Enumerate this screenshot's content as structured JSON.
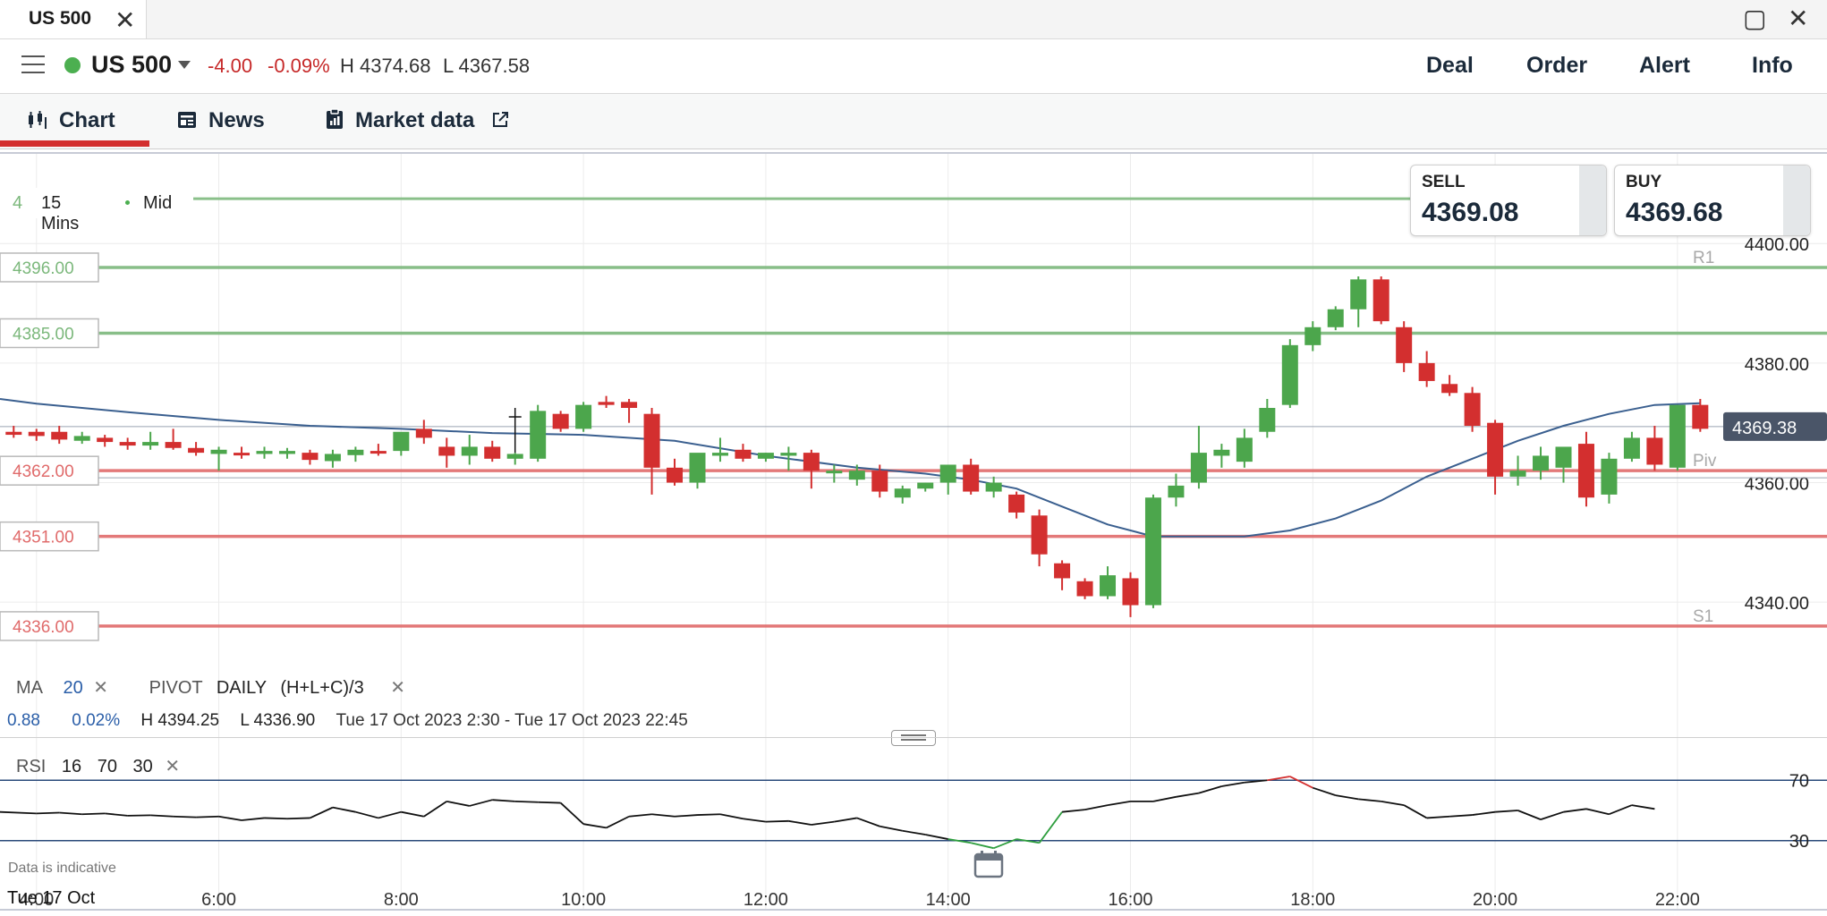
{
  "window": {
    "tab_title": "US 500",
    "close_glyph": "✕",
    "maximize_glyph": "▢",
    "window_close_glyph": "✕"
  },
  "header": {
    "instrument": "US 500",
    "change": "-4.00",
    "change_pct": "-0.09%",
    "high": "H 4374.68",
    "low": "L 4367.58",
    "actions": {
      "deal": "Deal",
      "order": "Order",
      "alert": "Alert",
      "info": "Info"
    }
  },
  "tabs": {
    "chart": "Chart",
    "news": "News",
    "market_data": "Market data"
  },
  "chart_controls": {
    "timeframe": "15 Mins",
    "price_type": "Mid",
    "cut_label": "4"
  },
  "quote": {
    "sell_label": "SELL",
    "sell_price": "4369.08",
    "buy_label": "BUY",
    "buy_price": "4369.68"
  },
  "indicators": {
    "ma_label": "MA",
    "ma_period": "20",
    "pivot_label": "PIVOT",
    "pivot_period": "DAILY",
    "pivot_formula": "(H+L+C)/3",
    "summary_change": "0.88",
    "summary_pct": "0.02%",
    "summary_high": "H 4394.25",
    "summary_low": "L 4336.90",
    "summary_range": "Tue 17 Oct 2023 2:30 - Tue 17 Oct 2023 22:45",
    "rsi_label": "RSI",
    "rsi_period": "16",
    "rsi_upper": "70",
    "rsi_lower": "30"
  },
  "footer": {
    "disclaimer": "Data is indicative",
    "date_label": "Tue 17 Oct"
  },
  "colors": {
    "up": "#4ca64c",
    "down": "#d32f2f",
    "ma": "#3a5f8f",
    "accent": "#d32f2f",
    "price_tag": "#4a5568"
  },
  "icons": {
    "menu": "menu-icon",
    "chart": "candlestick-icon",
    "news": "newspaper-icon",
    "market": "clipboard-icon",
    "external": "external-link-icon",
    "calendar": "calendar-icon"
  },
  "chart_data": {
    "type": "candlestick",
    "y_range": [
      4330,
      4415
    ],
    "y_ticks": [
      "4400.00",
      "4380.00",
      "4360.00",
      "4340.00"
    ],
    "y_tick_values": [
      4400,
      4380,
      4360,
      4340
    ],
    "x_range": [
      3.6,
      22.6
    ],
    "x_ticks": [
      "4:00",
      "6:00",
      "8:00",
      "10:00",
      "12:00",
      "14:00",
      "16:00",
      "18:00",
      "20:00",
      "22:00"
    ],
    "x_tick_values": [
      4,
      6,
      8,
      10,
      12,
      14,
      16,
      18,
      20,
      22
    ],
    "current_price": {
      "value": 4369.38,
      "label": "4369.38"
    },
    "levels": [
      {
        "value": 4396.0,
        "label": "4396.00",
        "kind": "resistance",
        "tag": "R1"
      },
      {
        "value": 4385.0,
        "label": "4385.00",
        "kind": "resistance",
        "tag": ""
      },
      {
        "value": 4362.0,
        "label": "4362.00",
        "kind": "support",
        "tag": "Piv"
      },
      {
        "value": 4351.0,
        "label": "4351.00",
        "kind": "support",
        "tag": ""
      },
      {
        "value": 4336.0,
        "label": "4336.00",
        "kind": "support",
        "tag": "S1"
      }
    ],
    "top_line_value": 4407.5,
    "candles": [
      {
        "t": 3.5,
        "o": 4368.0,
        "h": 4369.0,
        "l": 4367.0,
        "c": 4368.5
      },
      {
        "t": 3.75,
        "o": 4368.5,
        "h": 4369.5,
        "l": 4367.5,
        "c": 4368.0
      },
      {
        "t": 4.0,
        "o": 4368.5,
        "h": 4369.0,
        "l": 4367.0,
        "c": 4367.8
      },
      {
        "t": 4.25,
        "o": 4368.5,
        "h": 4369.5,
        "l": 4366.5,
        "c": 4367.2
      },
      {
        "t": 4.5,
        "o": 4367.0,
        "h": 4368.5,
        "l": 4366.5,
        "c": 4367.8
      },
      {
        "t": 4.75,
        "o": 4367.5,
        "h": 4368.0,
        "l": 4366.0,
        "c": 4366.8
      },
      {
        "t": 5.0,
        "o": 4366.8,
        "h": 4367.5,
        "l": 4365.5,
        "c": 4366.2
      },
      {
        "t": 5.25,
        "o": 4366.2,
        "h": 4368.5,
        "l": 4365.5,
        "c": 4366.8
      },
      {
        "t": 5.5,
        "o": 4366.8,
        "h": 4369.0,
        "l": 4365.5,
        "c": 4365.8
      },
      {
        "t": 5.75,
        "o": 4365.8,
        "h": 4366.8,
        "l": 4364.5,
        "c": 4365.0
      },
      {
        "t": 6.0,
        "o": 4364.8,
        "h": 4366.0,
        "l": 4362.0,
        "c": 4365.5
      },
      {
        "t": 6.25,
        "o": 4365.0,
        "h": 4366.0,
        "l": 4364.0,
        "c": 4364.6
      },
      {
        "t": 6.5,
        "o": 4364.8,
        "h": 4366.0,
        "l": 4364.0,
        "c": 4365.3
      },
      {
        "t": 6.75,
        "o": 4364.8,
        "h": 4365.8,
        "l": 4364.0,
        "c": 4365.3
      },
      {
        "t": 7.0,
        "o": 4365.0,
        "h": 4365.5,
        "l": 4363.0,
        "c": 4363.8
      },
      {
        "t": 7.25,
        "o": 4363.6,
        "h": 4365.5,
        "l": 4362.5,
        "c": 4364.8
      },
      {
        "t": 7.5,
        "o": 4364.6,
        "h": 4366.0,
        "l": 4363.5,
        "c": 4365.5
      },
      {
        "t": 7.75,
        "o": 4365.3,
        "h": 4366.5,
        "l": 4364.5,
        "c": 4365.0
      },
      {
        "t": 8.0,
        "o": 4365.3,
        "h": 4367.5,
        "l": 4364.5,
        "c": 4368.5
      },
      {
        "t": 8.25,
        "o": 4369.0,
        "h": 4370.5,
        "l": 4366.5,
        "c": 4367.5
      },
      {
        "t": 8.5,
        "o": 4366.0,
        "h": 4367.5,
        "l": 4362.5,
        "c": 4364.5
      },
      {
        "t": 8.75,
        "o": 4364.5,
        "h": 4368.0,
        "l": 4363.0,
        "c": 4366.0
      },
      {
        "t": 9.0,
        "o": 4366.0,
        "h": 4367.0,
        "l": 4363.5,
        "c": 4364.0
      },
      {
        "t": 9.25,
        "o": 4364.0,
        "h": 4365.0,
        "l": 4363.0,
        "c": 4364.8
      },
      {
        "t": 9.5,
        "o": 4364.0,
        "h": 4373.0,
        "l": 4363.5,
        "c": 4372.0
      },
      {
        "t": 9.75,
        "o": 4371.5,
        "h": 4372.0,
        "l": 4368.5,
        "c": 4369.0
      },
      {
        "t": 10.0,
        "o": 4369.0,
        "h": 4373.5,
        "l": 4368.5,
        "c": 4373.0
      },
      {
        "t": 10.25,
        "o": 4373.5,
        "h": 4374.5,
        "l": 4372.5,
        "c": 4373.0
      },
      {
        "t": 10.5,
        "o": 4373.5,
        "h": 4374.0,
        "l": 4370.0,
        "c": 4372.5
      },
      {
        "t": 10.75,
        "o": 4371.5,
        "h": 4372.5,
        "l": 4358.0,
        "c": 4362.5
      },
      {
        "t": 11.0,
        "o": 4362.5,
        "h": 4364.0,
        "l": 4359.5,
        "c": 4360.0
      },
      {
        "t": 11.25,
        "o": 4360.0,
        "h": 4364.5,
        "l": 4359.0,
        "c": 4365.0
      },
      {
        "t": 11.5,
        "o": 4364.5,
        "h": 4367.5,
        "l": 4363.5,
        "c": 4365.0
      },
      {
        "t": 11.75,
        "o": 4365.5,
        "h": 4366.5,
        "l": 4363.5,
        "c": 4364.0
      },
      {
        "t": 12.0,
        "o": 4364.0,
        "h": 4365.0,
        "l": 4363.5,
        "c": 4365.0
      },
      {
        "t": 12.25,
        "o": 4364.5,
        "h": 4366.0,
        "l": 4362.0,
        "c": 4365.0
      },
      {
        "t": 12.5,
        "o": 4365.0,
        "h": 4365.5,
        "l": 4359.0,
        "c": 4362.0
      },
      {
        "t": 12.75,
        "o": 4362.0,
        "h": 4363.0,
        "l": 4360.0,
        "c": 4362.0
      },
      {
        "t": 13.0,
        "o": 4360.5,
        "h": 4363.0,
        "l": 4359.5,
        "c": 4362.0
      },
      {
        "t": 13.25,
        "o": 4362.0,
        "h": 4363.0,
        "l": 4357.5,
        "c": 4358.5
      },
      {
        "t": 13.5,
        "o": 4357.5,
        "h": 4359.5,
        "l": 4356.5,
        "c": 4359.0
      },
      {
        "t": 13.75,
        "o": 4359.0,
        "h": 4360.0,
        "l": 4358.5,
        "c": 4360.0
      },
      {
        "t": 14.0,
        "o": 4360.0,
        "h": 4363.0,
        "l": 4358.0,
        "c": 4363.0
      },
      {
        "t": 14.25,
        "o": 4363.0,
        "h": 4364.0,
        "l": 4358.0,
        "c": 4358.5
      },
      {
        "t": 14.5,
        "o": 4358.5,
        "h": 4361.0,
        "l": 4357.5,
        "c": 4360.0
      },
      {
        "t": 14.75,
        "o": 4358.0,
        "h": 4358.5,
        "l": 4354.0,
        "c": 4355.0
      },
      {
        "t": 15.0,
        "o": 4354.5,
        "h": 4355.5,
        "l": 4346.0,
        "c": 4348.0
      },
      {
        "t": 15.25,
        "o": 4346.5,
        "h": 4347.0,
        "l": 4342.0,
        "c": 4344.0
      },
      {
        "t": 15.5,
        "o": 4343.5,
        "h": 4344.0,
        "l": 4340.5,
        "c": 4341.0
      },
      {
        "t": 15.75,
        "o": 4341.0,
        "h": 4346.0,
        "l": 4340.5,
        "c": 4344.5
      },
      {
        "t": 16.0,
        "o": 4344.0,
        "h": 4345.0,
        "l": 4337.5,
        "c": 4339.5
      },
      {
        "t": 16.25,
        "o": 4339.5,
        "h": 4358.0,
        "l": 4339.0,
        "c": 4357.5
      },
      {
        "t": 16.5,
        "o": 4357.5,
        "h": 4361.5,
        "l": 4356.0,
        "c": 4359.5
      },
      {
        "t": 16.75,
        "o": 4360.0,
        "h": 4369.5,
        "l": 4359.0,
        "c": 4365.0
      },
      {
        "t": 17.0,
        "o": 4364.5,
        "h": 4366.5,
        "l": 4362.5,
        "c": 4365.5
      },
      {
        "t": 17.25,
        "o": 4363.5,
        "h": 4369.0,
        "l": 4362.5,
        "c": 4367.5
      },
      {
        "t": 17.5,
        "o": 4368.5,
        "h": 4374.0,
        "l": 4367.5,
        "c": 4372.5
      },
      {
        "t": 17.75,
        "o": 4373.0,
        "h": 4384.0,
        "l": 4372.5,
        "c": 4383.0
      },
      {
        "t": 18.0,
        "o": 4383.0,
        "h": 4387.0,
        "l": 4382.0,
        "c": 4386.0
      },
      {
        "t": 18.25,
        "o": 4386.0,
        "h": 4389.5,
        "l": 4385.5,
        "c": 4389.0
      },
      {
        "t": 18.5,
        "o": 4389.0,
        "h": 4394.5,
        "l": 4386.0,
        "c": 4394.0
      },
      {
        "t": 18.75,
        "o": 4394.0,
        "h": 4394.5,
        "l": 4386.5,
        "c": 4387.0
      },
      {
        "t": 19.0,
        "o": 4386.0,
        "h": 4387.0,
        "l": 4378.5,
        "c": 4380.0
      },
      {
        "t": 19.25,
        "o": 4380.0,
        "h": 4382.0,
        "l": 4376.0,
        "c": 4377.0
      },
      {
        "t": 19.5,
        "o": 4376.5,
        "h": 4378.0,
        "l": 4374.5,
        "c": 4375.0
      },
      {
        "t": 19.75,
        "o": 4375.0,
        "h": 4376.0,
        "l": 4368.5,
        "c": 4369.5
      },
      {
        "t": 20.0,
        "o": 4370.0,
        "h": 4370.5,
        "l": 4358.0,
        "c": 4361.0
      },
      {
        "t": 20.25,
        "o": 4361.0,
        "h": 4364.5,
        "l": 4359.5,
        "c": 4362.0
      },
      {
        "t": 20.5,
        "o": 4362.0,
        "h": 4366.0,
        "l": 4360.5,
        "c": 4364.5
      },
      {
        "t": 20.75,
        "o": 4362.5,
        "h": 4365.5,
        "l": 4360.0,
        "c": 4366.0
      },
      {
        "t": 21.0,
        "o": 4366.5,
        "h": 4368.5,
        "l": 4356.0,
        "c": 4357.5
      },
      {
        "t": 21.25,
        "o": 4358.0,
        "h": 4365.0,
        "l": 4356.5,
        "c": 4364.0
      },
      {
        "t": 21.5,
        "o": 4364.0,
        "h": 4368.5,
        "l": 4363.5,
        "c": 4367.5
      },
      {
        "t": 21.75,
        "o": 4367.5,
        "h": 4369.5,
        "l": 4362.0,
        "c": 4363.0
      },
      {
        "t": 22.0,
        "o": 4362.5,
        "h": 4373.0,
        "l": 4362.0,
        "c": 4373.0
      },
      {
        "t": 22.25,
        "o": 4373.0,
        "h": 4374.0,
        "l": 4368.5,
        "c": 4369.0
      }
    ],
    "ma_series": [
      [
        3.6,
        4374.0
      ],
      [
        4.0,
        4373.2
      ],
      [
        5.0,
        4371.8
      ],
      [
        6.0,
        4370.5
      ],
      [
        7.0,
        4369.5
      ],
      [
        8.0,
        4369.0
      ],
      [
        9.0,
        4368.3
      ],
      [
        10.0,
        4368.0
      ],
      [
        11.0,
        4367.0
      ],
      [
        12.0,
        4364.5
      ],
      [
        13.0,
        4362.5
      ],
      [
        13.75,
        4361.5
      ],
      [
        14.25,
        4360.5
      ],
      [
        14.75,
        4359.0
      ],
      [
        15.25,
        4356.0
      ],
      [
        15.75,
        4353.0
      ],
      [
        16.25,
        4351.0
      ],
      [
        16.75,
        4351.0
      ],
      [
        17.25,
        4351.0
      ],
      [
        17.75,
        4352.0
      ],
      [
        18.25,
        4354.0
      ],
      [
        18.75,
        4357.0
      ],
      [
        19.25,
        4361.0
      ],
      [
        19.75,
        4364.0
      ],
      [
        20.25,
        4367.0
      ],
      [
        20.75,
        4369.5
      ],
      [
        21.25,
        4371.5
      ],
      [
        21.75,
        4373.0
      ],
      [
        22.25,
        4373.3
      ]
    ],
    "rsi": {
      "y_range": [
        18,
        82
      ],
      "levels": [
        70,
        30
      ],
      "series": [
        [
          3.6,
          49
        ],
        [
          4.0,
          48
        ],
        [
          4.25,
          48.5
        ],
        [
          4.5,
          47.5
        ],
        [
          4.75,
          48
        ],
        [
          5.0,
          46.5
        ],
        [
          5.25,
          46.8
        ],
        [
          5.5,
          46
        ],
        [
          5.75,
          45.5
        ],
        [
          6.0,
          46
        ],
        [
          6.25,
          43.5
        ],
        [
          6.5,
          45
        ],
        [
          6.75,
          44.5
        ],
        [
          7.0,
          45
        ],
        [
          7.25,
          52
        ],
        [
          7.5,
          49
        ],
        [
          7.75,
          45
        ],
        [
          8.0,
          49
        ],
        [
          8.25,
          46
        ],
        [
          8.5,
          56
        ],
        [
          8.75,
          53
        ],
        [
          9.0,
          57
        ],
        [
          9.25,
          56
        ],
        [
          9.5,
          55.5
        ],
        [
          9.75,
          55
        ],
        [
          10.0,
          41
        ],
        [
          10.25,
          38.5
        ],
        [
          10.5,
          46
        ],
        [
          10.75,
          47.5
        ],
        [
          11.0,
          46
        ],
        [
          11.25,
          47
        ],
        [
          11.5,
          47.5
        ],
        [
          11.75,
          44.5
        ],
        [
          12.0,
          42.5
        ],
        [
          12.25,
          43
        ],
        [
          12.5,
          40.5
        ],
        [
          12.75,
          42.5
        ],
        [
          13.0,
          45
        ],
        [
          13.25,
          39.5
        ],
        [
          13.5,
          36.5
        ],
        [
          13.75,
          34
        ],
        [
          14.0,
          31
        ],
        [
          14.25,
          28.5
        ],
        [
          14.5,
          25
        ],
        [
          14.75,
          31
        ],
        [
          15.0,
          28.5
        ],
        [
          15.25,
          49
        ],
        [
          15.5,
          50.5
        ],
        [
          15.75,
          53.5
        ],
        [
          16.0,
          56
        ],
        [
          16.25,
          56
        ],
        [
          16.5,
          59
        ],
        [
          16.75,
          61.5
        ],
        [
          17.0,
          66
        ],
        [
          17.25,
          68.5
        ],
        [
          17.5,
          70
        ],
        [
          17.75,
          72.5
        ],
        [
          18.0,
          65
        ],
        [
          18.25,
          60
        ],
        [
          18.5,
          57.5
        ],
        [
          18.75,
          56
        ],
        [
          19.0,
          53.5
        ],
        [
          19.25,
          45
        ],
        [
          19.5,
          46
        ],
        [
          19.75,
          47
        ],
        [
          20.0,
          49
        ],
        [
          20.25,
          50
        ],
        [
          20.5,
          44
        ],
        [
          20.75,
          49
        ],
        [
          21.0,
          51
        ],
        [
          21.25,
          47.5
        ],
        [
          21.5,
          53.5
        ],
        [
          21.75,
          51
        ]
      ]
    }
  }
}
